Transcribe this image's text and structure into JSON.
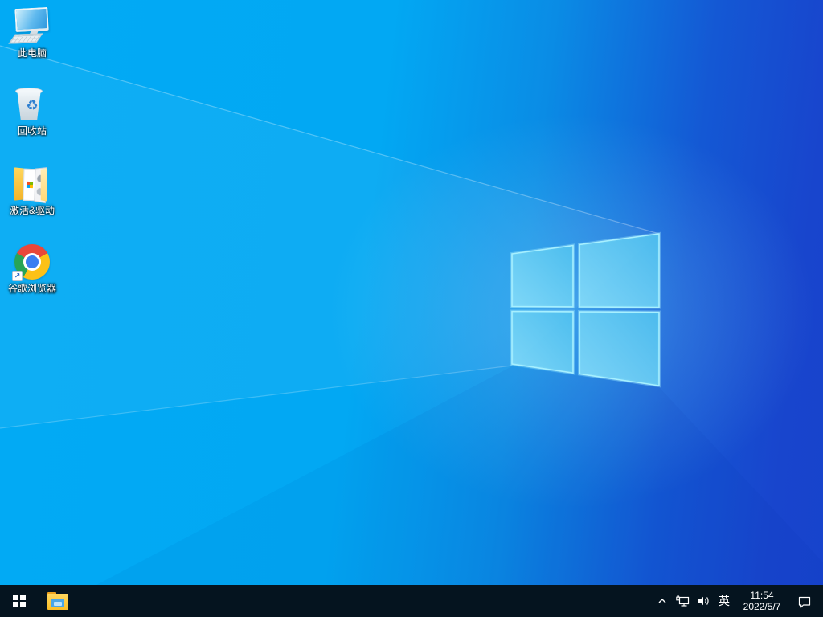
{
  "wallpaper": {
    "name": "windows-10-light-blue-default",
    "colors": {
      "left": "#02aaf4",
      "right": "#1743cc",
      "logo_pane_light": "#86dcf9",
      "logo_pane_dark": "#4fc1ef",
      "logo_edge": "#a7f0ff"
    }
  },
  "icons": {
    "recycle_glyph": "♻",
    "shortcut_arrow": "↗"
  },
  "desktop": {
    "icons": [
      {
        "name": "this-pc",
        "label": "此电脑"
      },
      {
        "name": "recycle-bin",
        "label": "回收站"
      },
      {
        "name": "activation-drivers-folder",
        "label": "激活&驱动"
      },
      {
        "name": "google-chrome",
        "label": "谷歌浏览器"
      }
    ]
  },
  "taskbar": {
    "colors": {
      "background": "#05141f",
      "foreground": "#ffffff"
    },
    "start_button_icon": "windows-logo",
    "pinned": [
      {
        "icon": "file-explorer"
      }
    ],
    "tray": {
      "show_hidden_icons_icon": "chevron-up",
      "network_icon": "network-ethernet",
      "volume_icon": "speaker-sound",
      "input_indicator": "英",
      "clock": {
        "time": "11:54",
        "date": "2022/5/7"
      },
      "action_center_icon": "notification-bubble"
    }
  }
}
